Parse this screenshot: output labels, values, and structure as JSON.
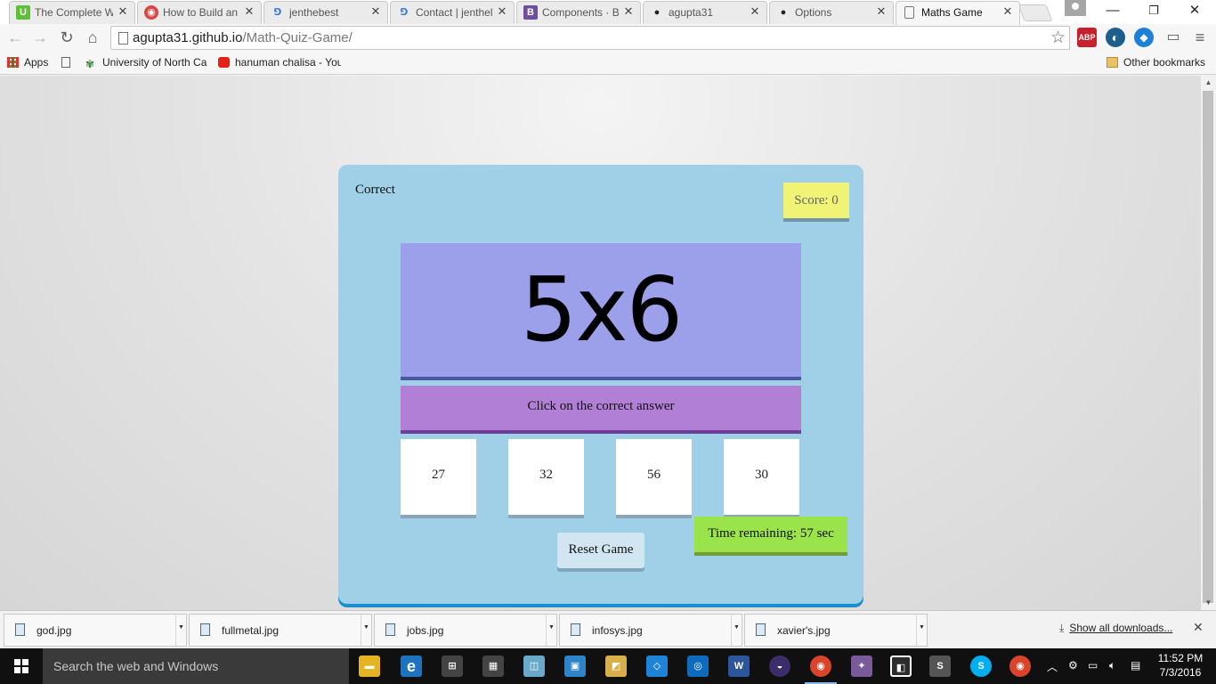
{
  "browser": {
    "tabs": [
      {
        "title": "The Complete W",
        "icon": "udemy-icon",
        "color": "#5fbf3a",
        "glyph": "U"
      },
      {
        "title": "How to Build an",
        "icon": "codepen-icon",
        "color": "#d94646",
        "glyph": "◉"
      },
      {
        "title": "jenthebest",
        "icon": "wix-icon",
        "color": "#3f7ad6",
        "glyph": "⅁"
      },
      {
        "title": "Contact | jenthel",
        "icon": "wix-icon",
        "color": "#3f7ad6",
        "glyph": "⅁"
      },
      {
        "title": "Components · B",
        "icon": "bootstrap-icon",
        "color": "#6f4f99",
        "glyph": "B"
      },
      {
        "title": "agupta31",
        "icon": "github-icon",
        "color": "#222222",
        "glyph": "●"
      },
      {
        "title": "Options",
        "icon": "github-icon",
        "color": "#222222",
        "glyph": "●"
      },
      {
        "title": "Maths Game",
        "icon": "page-icon",
        "color": "#ffffff",
        "glyph": "",
        "active": true
      }
    ],
    "url_host": "agupta31.github.io",
    "url_path": "/Math-Quiz-Game/",
    "bookmarks": [
      {
        "label": "Apps",
        "icon": "apps-grid-icon"
      },
      {
        "label": "",
        "icon": "page-icon"
      },
      {
        "label": "University of North Ca",
        "icon": "university-icon"
      },
      {
        "label": "hanuman chalisa - You",
        "icon": "youtube-icon"
      }
    ],
    "other_bookmarks": "Other bookmarks",
    "extensions": [
      {
        "name": "adblock-plus-icon",
        "label": "ABP",
        "color": "#c6212d"
      },
      {
        "name": "extension-globe-icon",
        "label": "◐",
        "color": "#1d5f8c"
      },
      {
        "name": "extension-bird-icon",
        "label": "◆",
        "color": "#1c7fd8"
      }
    ]
  },
  "game": {
    "correct_message": "Correct",
    "score_label": "Score: 0",
    "question": "5x6",
    "instruction": "Click on the correct answer",
    "choices": [
      "27",
      "32",
      "56",
      "30"
    ],
    "timer_label": "Time remaining: 57 sec",
    "reset_label": "Reset Game"
  },
  "downloads": {
    "items": [
      "god.jpg",
      "fullmetal.jpg",
      "jobs.jpg",
      "infosys.jpg",
      "xavier's.jpg"
    ],
    "show_all": "Show all downloads..."
  },
  "taskbar": {
    "search_placeholder": "Search the web and Windows",
    "apps": [
      {
        "name": "file-explorer-icon",
        "glyph": "▬",
        "color": "#e6b422"
      },
      {
        "name": "edge-icon",
        "glyph": "e",
        "color": "#1e73be"
      },
      {
        "name": "store-icon",
        "glyph": "⊞",
        "color": "#444444"
      },
      {
        "name": "calculator-icon",
        "glyph": "▦",
        "color": "#444444"
      },
      {
        "name": "sticky-notes-icon",
        "glyph": "◫",
        "color": "#6aa9c9"
      },
      {
        "name": "photos-icon",
        "glyph": "▣",
        "color": "#2e84c8"
      },
      {
        "name": "folder-icon",
        "glyph": "◩",
        "color": "#d8b04a"
      },
      {
        "name": "dropbox-icon",
        "glyph": "◇",
        "color": "#1e84d8"
      },
      {
        "name": "outlook-icon",
        "glyph": "◎",
        "color": "#0f6cbd"
      },
      {
        "name": "word-icon",
        "glyph": "W",
        "color": "#2b579a"
      },
      {
        "name": "eclipse-icon",
        "glyph": "◒",
        "color": "#3b2d69"
      },
      {
        "name": "chrome-icon",
        "glyph": "◉",
        "color": "#d9442b"
      },
      {
        "name": "sniper-icon",
        "glyph": "✦",
        "color": "#7a5a9a"
      },
      {
        "name": "app-icon",
        "glyph": "◧",
        "color": "#2c2c2c"
      },
      {
        "name": "sublime-icon",
        "glyph": "S",
        "color": "#555555"
      },
      {
        "name": "skype-icon",
        "glyph": "S",
        "color": "#00aff0"
      },
      {
        "name": "chrome-icon-2",
        "glyph": "◉",
        "color": "#d9442b"
      }
    ],
    "time": "11:52 PM",
    "date": "7/3/2016"
  }
}
